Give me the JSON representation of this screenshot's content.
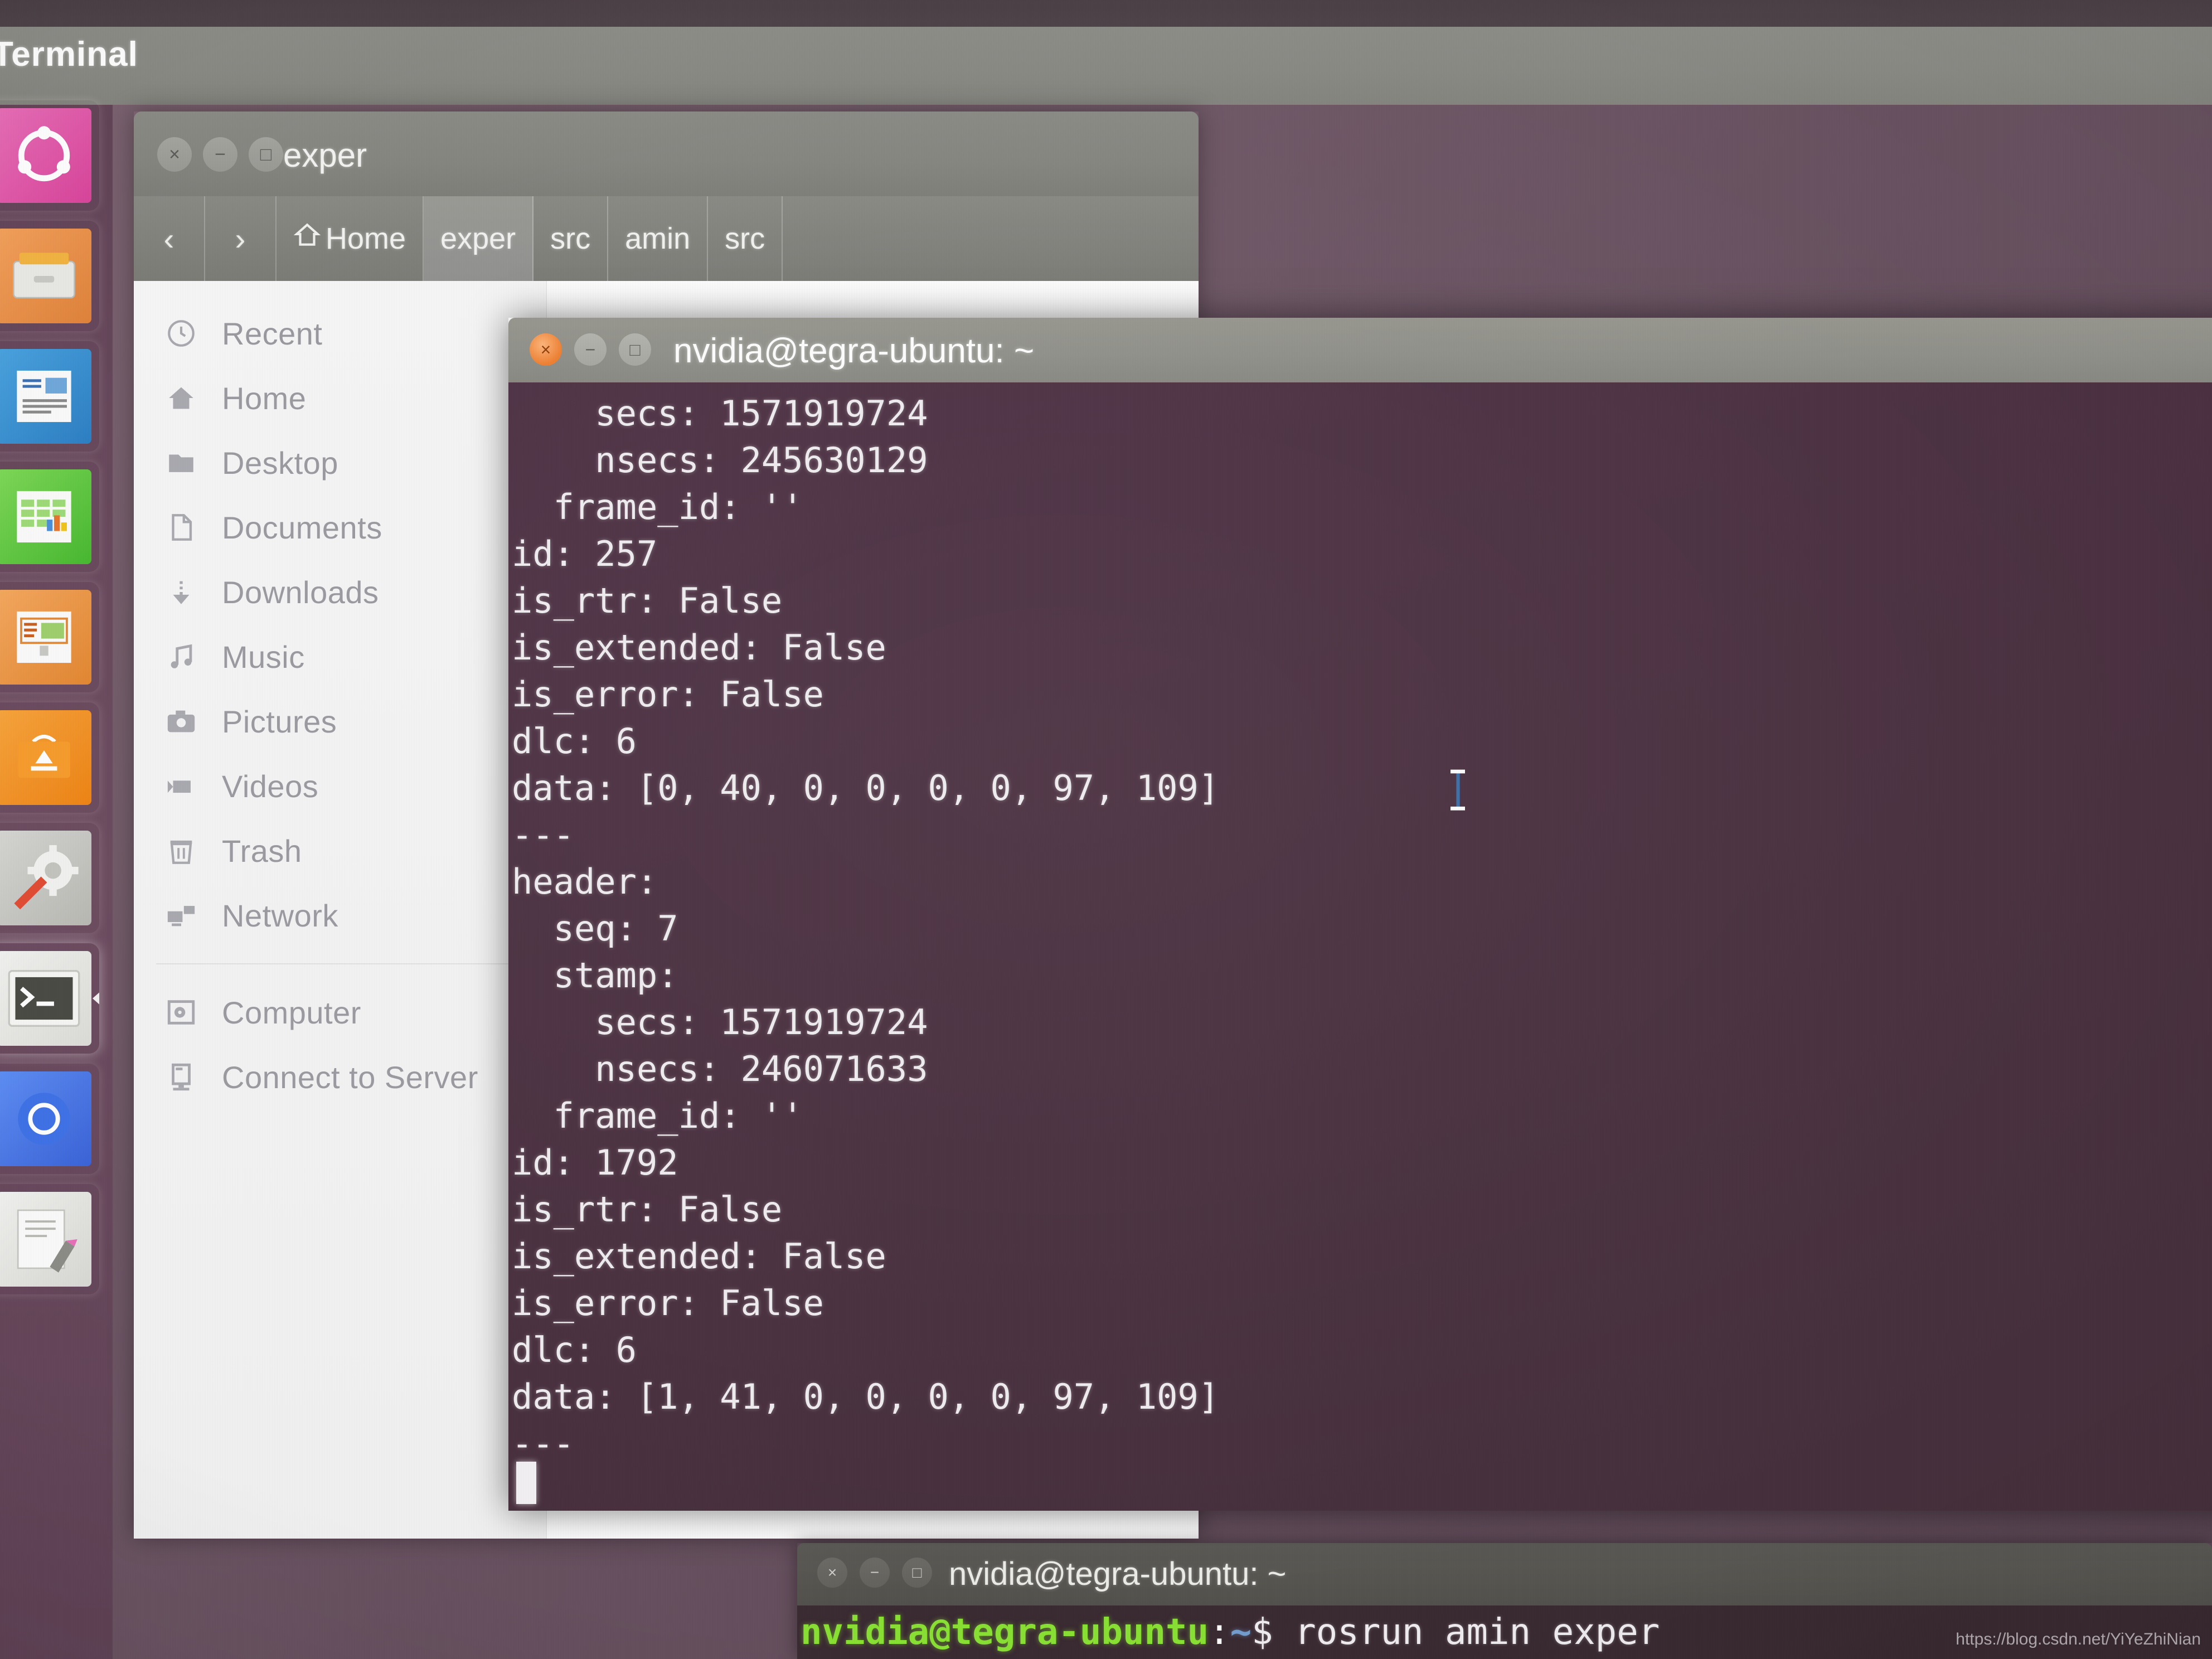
{
  "desktop": {
    "app_menu_title": "Terminal",
    "launcher": {
      "items": [
        {
          "name": "ubuntu-dash",
          "label": "Ubuntu Dash"
        },
        {
          "name": "files",
          "label": "Files"
        },
        {
          "name": "libreoffice-writer",
          "label": "LibreOffice Writer"
        },
        {
          "name": "libreoffice-calc",
          "label": "LibreOffice Calc"
        },
        {
          "name": "libreoffice-impress",
          "label": "LibreOffice Impress"
        },
        {
          "name": "ubuntu-software",
          "label": "Ubuntu Software"
        },
        {
          "name": "system-settings",
          "label": "System Settings"
        },
        {
          "name": "terminal",
          "label": "Terminal"
        },
        {
          "name": "chromium",
          "label": "Chromium Web Browser"
        },
        {
          "name": "text-editor",
          "label": "Text Editor"
        }
      ]
    }
  },
  "file_manager": {
    "title": "exper",
    "window_buttons": {
      "close": "×",
      "minimize": "−",
      "maximize": "□"
    },
    "nav": {
      "back": "‹",
      "forward": "›"
    },
    "breadcrumb": [
      {
        "label": "Home",
        "icon": "home-icon",
        "active": false
      },
      {
        "label": "exper",
        "icon": "",
        "active": true
      },
      {
        "label": "src",
        "icon": "",
        "active": false
      },
      {
        "label": "amin",
        "icon": "",
        "active": false
      },
      {
        "label": "src",
        "icon": "",
        "active": false
      }
    ],
    "places": [
      {
        "label": "Recent",
        "icon": "clock-icon"
      },
      {
        "label": "Home",
        "icon": "home-icon"
      },
      {
        "label": "Desktop",
        "icon": "folder-icon"
      },
      {
        "label": "Documents",
        "icon": "document-icon"
      },
      {
        "label": "Downloads",
        "icon": "download-icon"
      },
      {
        "label": "Music",
        "icon": "music-note-icon"
      },
      {
        "label": "Pictures",
        "icon": "camera-icon"
      },
      {
        "label": "Videos",
        "icon": "video-camera-icon"
      },
      {
        "label": "Trash",
        "icon": "trash-icon"
      },
      {
        "label": "Network",
        "icon": "network-icon"
      },
      {
        "label": "Computer",
        "icon": "computer-disk-icon"
      },
      {
        "label": "Connect to Server",
        "icon": "server-icon"
      }
    ]
  },
  "terminal_main": {
    "title": "nvidia@tegra-ubuntu: ~",
    "window_buttons": {
      "close": "×",
      "minimize": "−",
      "maximize": "□"
    },
    "lines": [
      "    secs: 1571919724",
      "    nsecs: 245630129",
      "  frame_id: ''",
      "id: 257",
      "is_rtr: False",
      "is_extended: False",
      "is_error: False",
      "dlc: 6",
      "data: [0, 40, 0, 0, 0, 0, 97, 109]",
      "---",
      "header: ",
      "  seq: 7",
      "  stamp: ",
      "    secs: 1571919724",
      "    nsecs: 246071633",
      "  frame_id: ''",
      "id: 1792",
      "is_rtr: False",
      "is_extended: False",
      "is_error: False",
      "dlc: 6",
      "data: [1, 41, 0, 0, 0, 0, 97, 109]",
      "---"
    ]
  },
  "terminal_back": {
    "title": "nvidia@tegra-ubuntu: ~",
    "window_buttons": {
      "close": "×",
      "minimize": "−",
      "maximize": "□"
    },
    "prompt_user": "nvidia@tegra-ubuntu",
    "prompt_colon": ":",
    "prompt_path": "~",
    "prompt_symbol": "$ ",
    "command": "rosrun amin exper"
  },
  "watermark": {
    "text": "https://blog.csdn.net/YiYeZhiNian"
  },
  "colors": {
    "terminal_bg": "#4a3040",
    "terminal_bg_back": "#3a2a32",
    "prompt_green": "#8ae234",
    "prompt_blue": "#729fcf",
    "close_orange": "#ef7f2f",
    "launcher_bg": "#6c4a5f",
    "titlebar_grey": "#8a8a85"
  }
}
